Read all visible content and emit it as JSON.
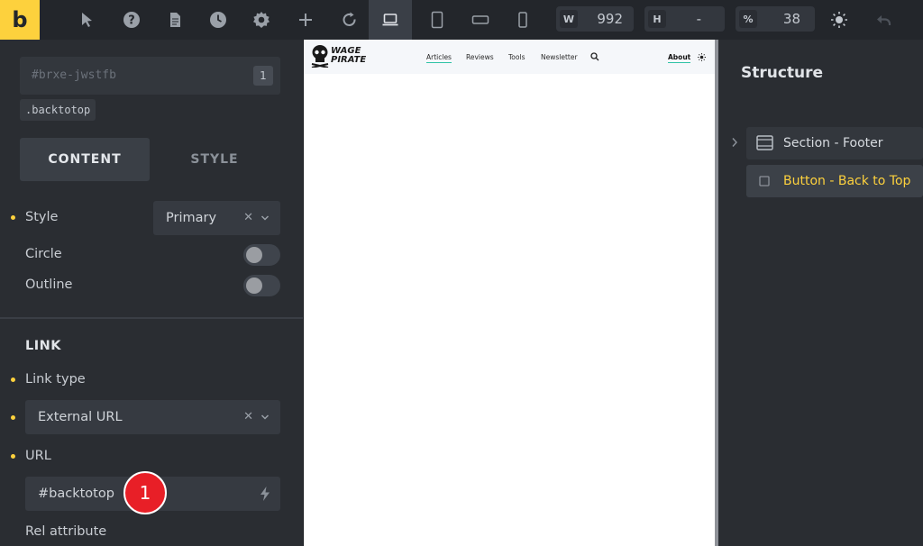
{
  "app": {
    "logo_letter": "b",
    "accent_color": "#fdd13d"
  },
  "toolbar": {
    "icons": [
      "cursor-icon",
      "help-icon",
      "page-icon",
      "history-icon",
      "settings-icon",
      "add-icon",
      "refresh-icon",
      "laptop-icon",
      "tablet-portrait-icon",
      "tablet-landscape-icon",
      "mobile-icon",
      "sun-icon",
      "undo-icon"
    ],
    "width": {
      "label": "W",
      "value": "992"
    },
    "height": {
      "label": "H",
      "value": "-"
    },
    "zoom": {
      "label": "%",
      "value": "38"
    }
  },
  "panel": {
    "element_id": "#brxe-jwstfb",
    "element_count": "1",
    "class_name": ".backtotop",
    "tabs": {
      "content": "CONTENT",
      "style": "STYLE"
    },
    "style_label": "Style",
    "style_value": "Primary",
    "clear_symbol": "✕",
    "circle_label": "Circle",
    "outline_label": "Outline",
    "link_section": "LINK",
    "link_type_label": "Link type",
    "link_type_value": "External URL",
    "url_label": "URL",
    "url_value": "#backtotop",
    "rel_label": "Rel attribute",
    "step_badge": "1"
  },
  "preview": {
    "logo_line1": "WAGE",
    "logo_line2": "PIRATE",
    "nav": [
      "Articles",
      "Reviews",
      "Tools",
      "Newsletter"
    ],
    "about": "About"
  },
  "structure": {
    "title": "Structure",
    "items": [
      {
        "label": "Section - Footer",
        "color": "#d7dbe0"
      },
      {
        "label": "Button - Back to Top",
        "color": "#fdd13d"
      }
    ]
  }
}
